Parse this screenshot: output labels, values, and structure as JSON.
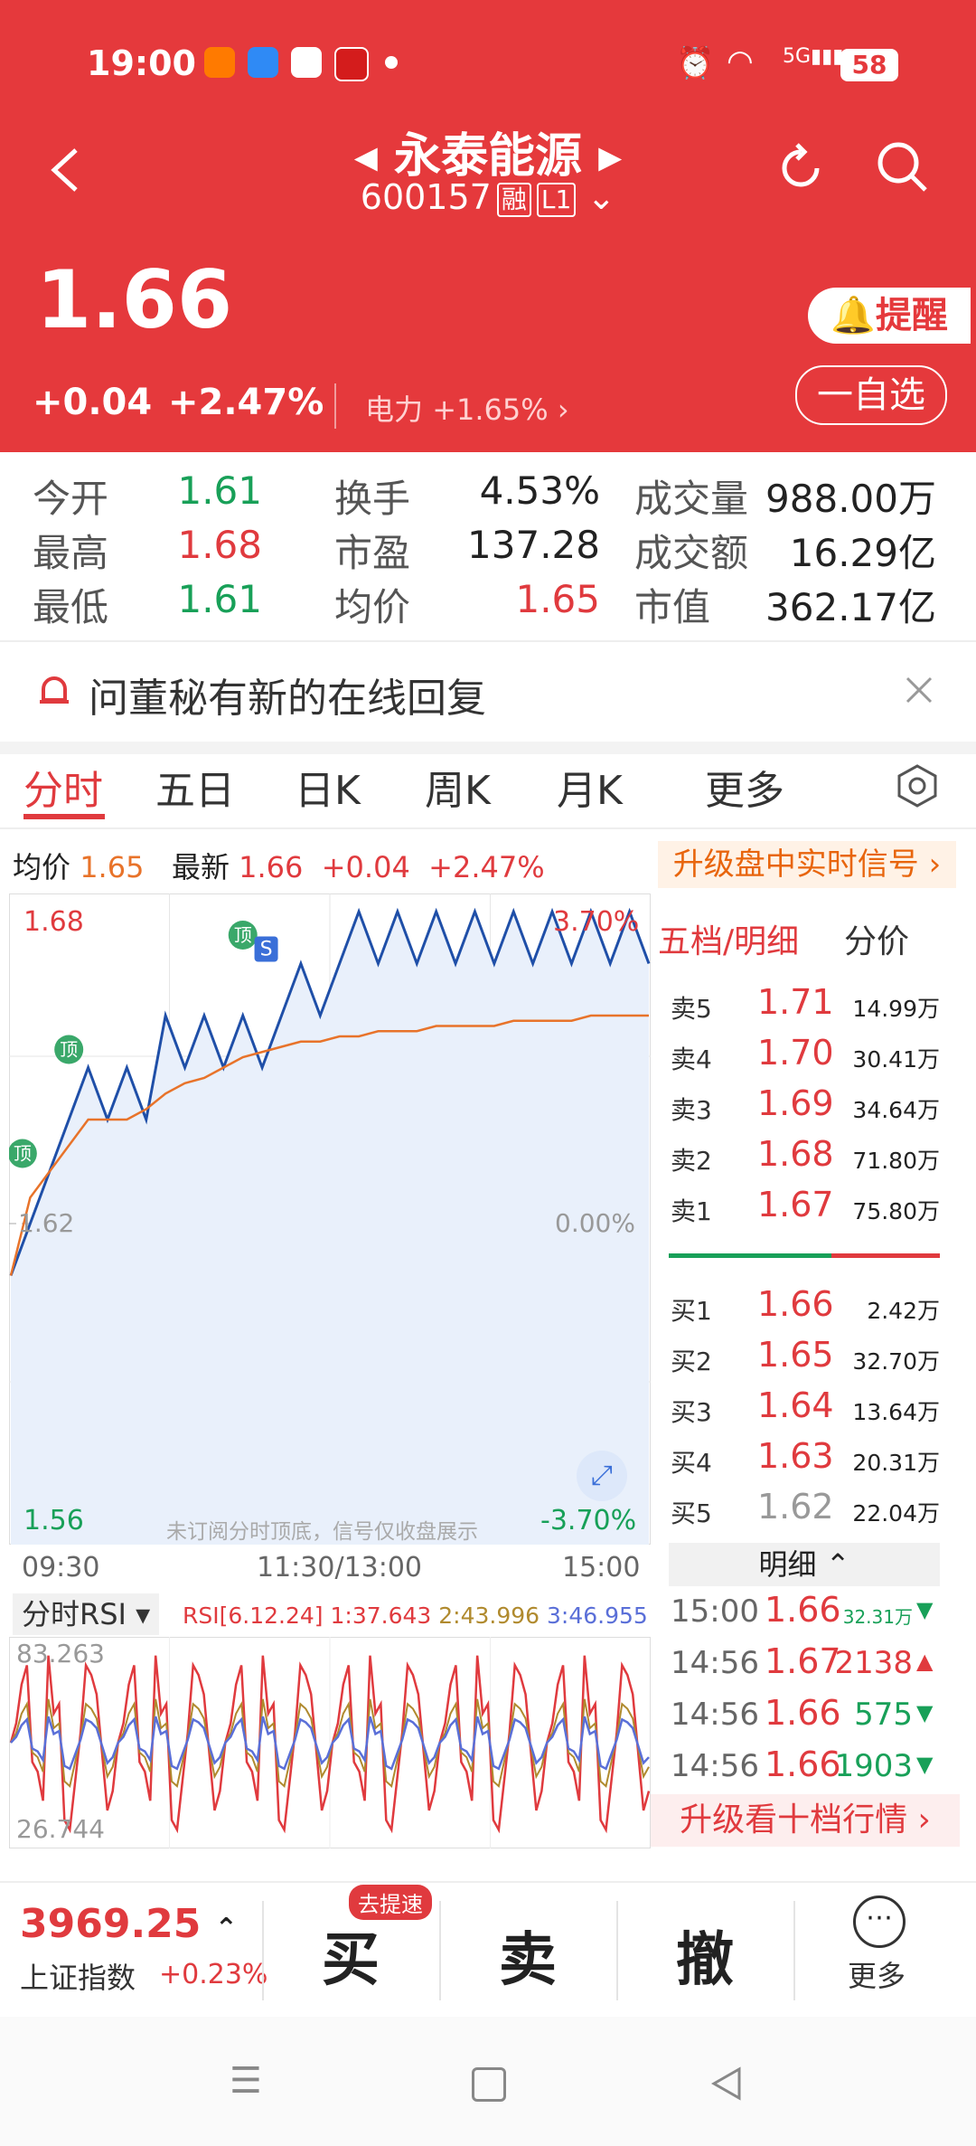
{
  "status": {
    "time": "19:00",
    "battery": "58",
    "net": "5G"
  },
  "header": {
    "name": "永泰能源",
    "code": "600157",
    "tag1": "融",
    "tag2": "L1"
  },
  "quote": {
    "price": "1.66",
    "change": "+0.04",
    "pct": "+2.47%",
    "sector": "电力",
    "sector_pct": "+1.65%",
    "remind": "提醒",
    "watch": "一自选"
  },
  "stats": [
    {
      "label": "今开",
      "value": "1.61",
      "color": "green"
    },
    {
      "label": "换手",
      "value": "4.53%",
      "color": "dark"
    },
    {
      "label": "成交量",
      "value": "988.00万",
      "color": "dark"
    },
    {
      "label": "最高",
      "value": "1.68",
      "color": "red"
    },
    {
      "label": "市盈",
      "value": "137.28",
      "color": "dark"
    },
    {
      "label": "成交额",
      "value": "16.29亿",
      "color": "dark"
    },
    {
      "label": "最低",
      "value": "1.61",
      "color": "green"
    },
    {
      "label": "均价",
      "value": "1.65",
      "color": "red"
    },
    {
      "label": "市值",
      "value": "362.17亿",
      "color": "dark"
    }
  ],
  "notice": "问董秘有新的在线回复",
  "tabs": [
    "分时",
    "五日",
    "日K",
    "周K",
    "月K",
    "更多"
  ],
  "info": {
    "avg_label": "均价",
    "avg": "1.65",
    "last_label": "最新",
    "last": "1.66",
    "chg": "+0.04",
    "pct": "+2.47%",
    "upgrade": "升级盘中实时信号"
  },
  "chart_data": {
    "type": "line",
    "y_labels": {
      "top": "1.68",
      "mid": "1.62",
      "bottom": "1.56",
      "top_pct": "3.70%",
      "mid_pct": "0.00%",
      "bottom_pct": "-3.70%"
    },
    "x_labels": [
      "09:30",
      "11:30/13:00",
      "15:00"
    ],
    "watermark": "未订阅分时顶底，信号仅收盘展示",
    "markers": [
      "顶",
      "顶",
      "顶",
      "S"
    ],
    "series": [
      {
        "color": "#1f4fa8",
        "values": [
          1.61,
          1.62,
          1.63,
          1.64,
          1.65,
          1.64,
          1.65,
          1.64,
          1.66,
          1.65,
          1.66,
          1.65,
          1.66,
          1.65,
          1.66,
          1.67,
          1.66,
          1.67,
          1.68,
          1.67,
          1.68,
          1.67,
          1.68,
          1.67,
          1.68,
          1.67,
          1.68,
          1.67,
          1.68,
          1.67,
          1.68,
          1.67,
          1.68,
          1.67
        ]
      },
      {
        "color": "#e8732a",
        "values": [
          1.61,
          1.625,
          1.63,
          1.635,
          1.64,
          1.64,
          1.64,
          1.642,
          1.645,
          1.647,
          1.648,
          1.65,
          1.652,
          1.653,
          1.654,
          1.655,
          1.655,
          1.656,
          1.656,
          1.657,
          1.657,
          1.657,
          1.658,
          1.658,
          1.658,
          1.658,
          1.659,
          1.659,
          1.659,
          1.659,
          1.66,
          1.66,
          1.66,
          1.66
        ]
      }
    ],
    "ylim": [
      1.56,
      1.68
    ]
  },
  "rsi": {
    "title": "分时RSI",
    "p": "RSI[6.12.24]",
    "r1": "1:37.643",
    "r2": "2:43.996",
    "r3": "3:46.955",
    "top": "83.263",
    "bottom": "26.744"
  },
  "orderbook": {
    "title": "五档/明细",
    "title2": "分价",
    "asks": [
      {
        "l": "卖5",
        "p": "1.71",
        "v": "14.99万"
      },
      {
        "l": "卖4",
        "p": "1.70",
        "v": "30.41万"
      },
      {
        "l": "卖3",
        "p": "1.69",
        "v": "34.64万"
      },
      {
        "l": "卖2",
        "p": "1.68",
        "v": "71.80万"
      },
      {
        "l": "卖1",
        "p": "1.67",
        "v": "75.80万"
      }
    ],
    "bids": [
      {
        "l": "买1",
        "p": "1.66",
        "v": "2.42万"
      },
      {
        "l": "买2",
        "p": "1.65",
        "v": "32.70万"
      },
      {
        "l": "买3",
        "p": "1.64",
        "v": "13.64万"
      },
      {
        "l": "买4",
        "p": "1.63",
        "v": "20.31万"
      },
      {
        "l": "买5",
        "p": "1.62",
        "v": "22.04万"
      }
    ],
    "detail_title": "明细",
    "ticks": [
      {
        "t": "15:00",
        "p": "1.66",
        "v": "32.31万",
        "dir": "down"
      },
      {
        "t": "14:56",
        "p": "1.67",
        "v": "2138",
        "dir": "up"
      },
      {
        "t": "14:56",
        "p": "1.66",
        "v": "575",
        "dir": "down"
      },
      {
        "t": "14:56",
        "p": "1.66",
        "v": "1903",
        "dir": "down"
      }
    ],
    "upgrade": "升级看十档行情"
  },
  "bottom": {
    "index_value": "3969.25",
    "index_name": "上证指数",
    "index_pct": "+0.23%",
    "badge": "去提速",
    "buy": "买",
    "sell": "卖",
    "cancel": "撤",
    "more": "更多"
  }
}
